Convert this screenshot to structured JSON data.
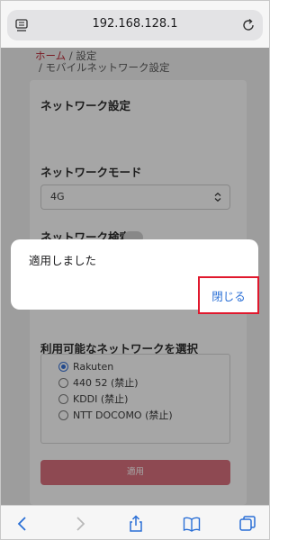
{
  "browser": {
    "url": "192.168.128.1"
  },
  "breadcrumb": {
    "home": "ホーム",
    "sep1": " / ",
    "settings": "設定",
    "line2": "/ モバイルネットワーク設定"
  },
  "form": {
    "section_title": "ネットワーク設定",
    "mode_label": "ネットワークモード",
    "mode_value": "4G",
    "search_label": "ネットワーク検索",
    "carrier_label": "利用可能なネットワークを選択",
    "carriers": [
      {
        "label": "Rakuten",
        "selected": true
      },
      {
        "label": "440 52 (禁止)",
        "selected": false
      },
      {
        "label": "KDDI (禁止)",
        "selected": false
      },
      {
        "label": "NTT DOCOMO (禁止)",
        "selected": false
      }
    ],
    "apply_label": "適用"
  },
  "dialog": {
    "message": "適用しました",
    "close_label": "閉じる"
  },
  "colors": {
    "accent_red": "#b8202e",
    "link_blue": "#2a6fd6",
    "highlight": "#e0182d"
  },
  "toolbar": {
    "icons": [
      "back-icon",
      "forward-icon",
      "share-icon",
      "bookmarks-icon",
      "tabs-icon"
    ]
  }
}
